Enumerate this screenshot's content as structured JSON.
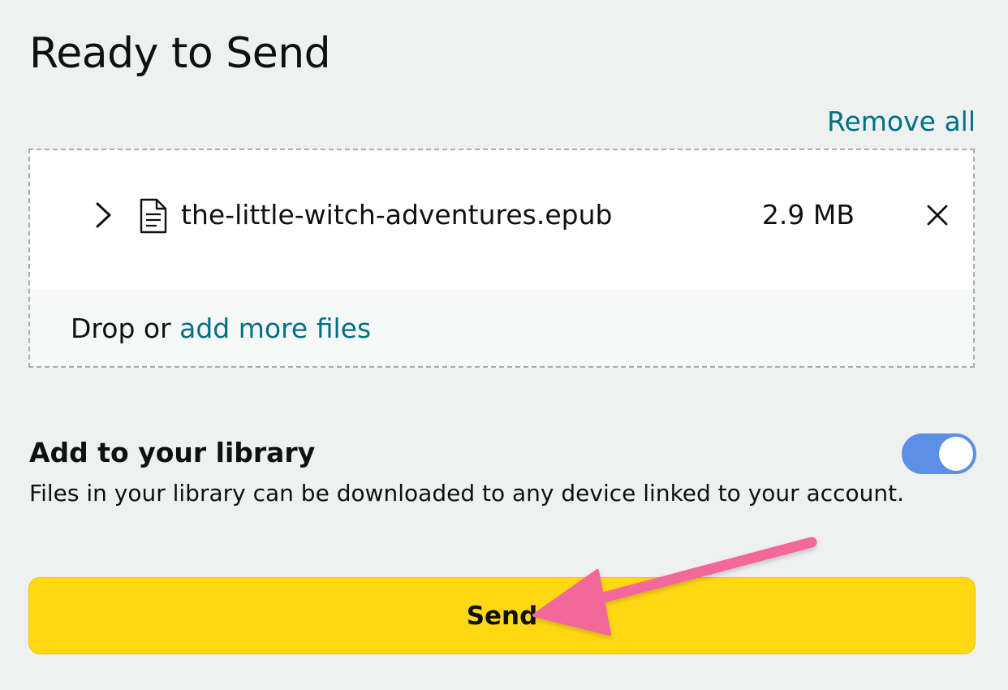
{
  "page": {
    "title": "Ready to Send"
  },
  "upload": {
    "remove_all_label": "Remove all",
    "files": [
      {
        "name": "the-little-witch-adventures.epub",
        "size": "2.9 MB"
      }
    ],
    "drop_prefix": "Drop or ",
    "add_more_label": "add more files"
  },
  "library": {
    "heading": "Add to your library",
    "description": "Files in your library can be downloaded to any device linked to your account.",
    "toggle_on": true
  },
  "actions": {
    "send_label": "Send"
  },
  "icons": {
    "expand": "chevron-right-icon",
    "file": "document-icon",
    "remove": "close-icon",
    "annotation": "pink-arrow-annotation"
  },
  "colors": {
    "link": "#007185",
    "toggle": "#5d8fe6",
    "send_button": "#ffd814",
    "annotation_arrow": "#f2679a",
    "background": "#eff0f0"
  }
}
